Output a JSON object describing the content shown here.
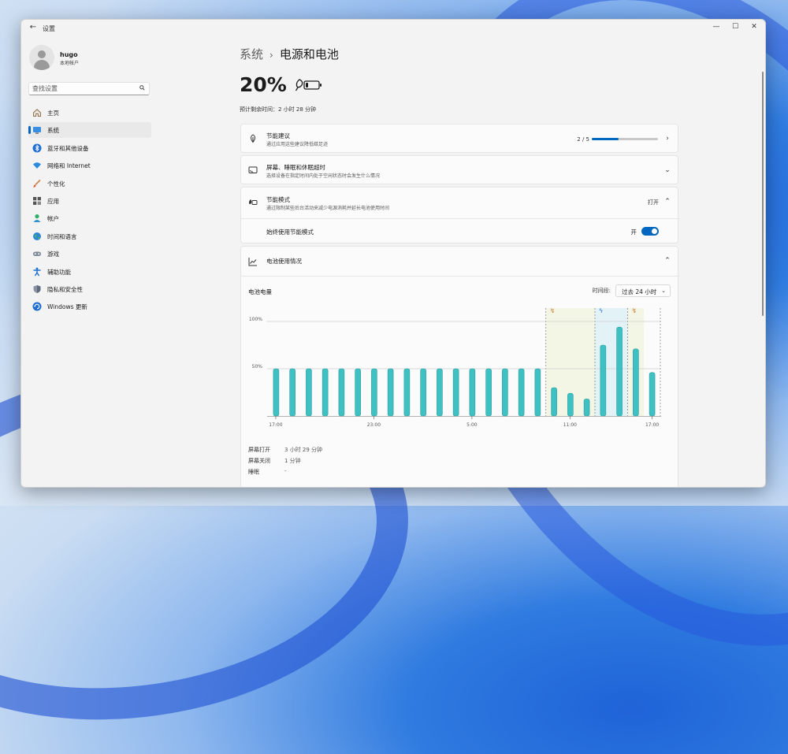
{
  "window": {
    "title": "设置",
    "controls": [
      "—",
      "☐",
      "✕"
    ]
  },
  "profile": {
    "name": "hugo",
    "subtitle": "本地帐户"
  },
  "search": {
    "placeholder": "查找设置"
  },
  "nav": [
    {
      "label": "主页",
      "icon": "home-icon",
      "active": false
    },
    {
      "label": "系统",
      "icon": "system-icon",
      "active": true
    },
    {
      "label": "蓝牙和其他设备",
      "icon": "bluetooth-icon",
      "active": false
    },
    {
      "label": "网络和 Internet",
      "icon": "network-icon",
      "active": false
    },
    {
      "label": "个性化",
      "icon": "brush-icon",
      "active": false
    },
    {
      "label": "应用",
      "icon": "apps-icon",
      "active": false
    },
    {
      "label": "帐户",
      "icon": "account-icon",
      "active": false
    },
    {
      "label": "时间和语言",
      "icon": "globe-icon",
      "active": false
    },
    {
      "label": "游戏",
      "icon": "gamepad-icon",
      "active": false
    },
    {
      "label": "辅助功能",
      "icon": "accessibility-icon",
      "active": false
    },
    {
      "label": "隐私和安全性",
      "icon": "shield-icon",
      "active": false
    },
    {
      "label": "Windows 更新",
      "icon": "update-icon",
      "active": false
    }
  ],
  "breadcrumb": {
    "parent": "系统",
    "separator": "›",
    "current": "电源和电池"
  },
  "battery": {
    "percent": "20%",
    "level": 0.2,
    "remaining": "预计剩余时间：2 小时 28 分钟"
  },
  "cards": {
    "recommendations": {
      "title": "节能建议",
      "subtitle": "通过应用这些建议降低碳足迹",
      "progress": "2 / 5",
      "progress_value": 0.4
    },
    "screen_sleep": {
      "title": "屏幕、睡眠和休眠超时",
      "subtitle": "选择设备在指定时间内处于空闲状态时会发生什么情况"
    },
    "energy_saver": {
      "title": "节能模式",
      "subtitle": "通过限制某些后台活动来减少电源消耗并延长电池使用时间",
      "status": "打开",
      "row_label": "始终使用节能模式",
      "toggle_label": "开",
      "toggle_on": true
    },
    "usage": {
      "title": "电池使用情况",
      "chart_title": "电池电量",
      "period_label": "时间段:",
      "period_value": "过去 24 小时"
    }
  },
  "chart_data": {
    "type": "bar",
    "title": "电池电量",
    "y_ticks": [
      "100%",
      "50%"
    ],
    "x_ticks": [
      "17:00",
      "23:00",
      "5:00",
      "11:00",
      "17:00"
    ],
    "ylim": [
      0,
      100
    ],
    "values": [
      50,
      50,
      50,
      50,
      50,
      50,
      50,
      50,
      50,
      50,
      50,
      50,
      50,
      50,
      50,
      50,
      50,
      30,
      24,
      18,
      75,
      94,
      71,
      46
    ],
    "colors": {
      "bar": "#3fc0c2",
      "bar_edge": "#2a9fa1",
      "saver_band": "#f3f6e4",
      "charge_band": "#e3f2f7",
      "grid": "#cfcfcf"
    }
  },
  "usage_stats": [
    {
      "label": "屏幕打开",
      "value": "3 小时 29 分钟"
    },
    {
      "label": "屏幕关闭",
      "value": "1 分钟"
    },
    {
      "label": "睡眠",
      "value": "-"
    }
  ]
}
